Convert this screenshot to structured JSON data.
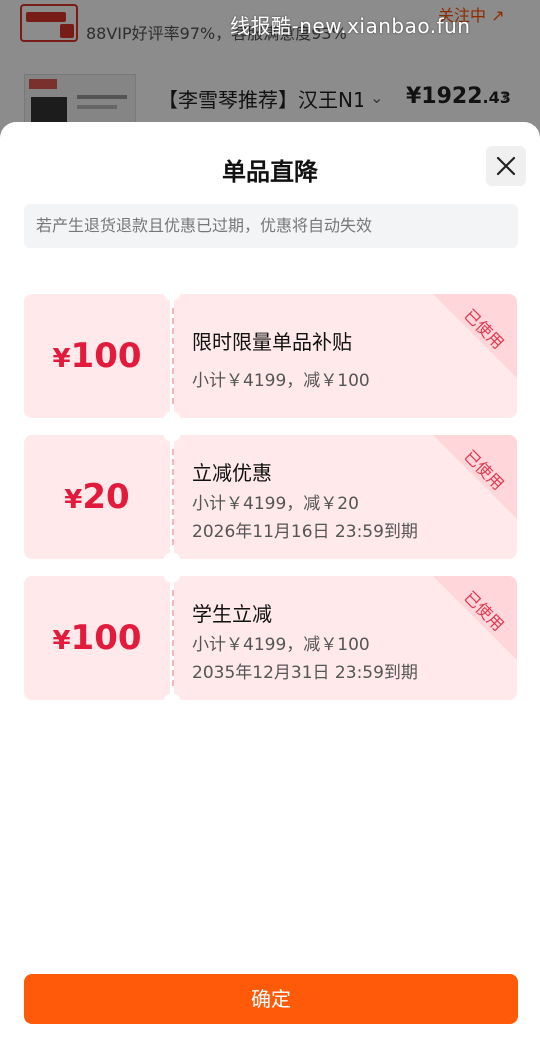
{
  "watermark": "线报酷-new.xianbao.fun",
  "background": {
    "shop_rating": "88VIP好评率97%，客服满意度93%",
    "follow_label": "关注中 ↗",
    "product_name": "【李雪琴推荐】汉王N1",
    "product_chevron": "⌄",
    "price_main": "¥1922",
    "price_decimal": ".43",
    "price_chevron": "›"
  },
  "sheet": {
    "title": "单品直降",
    "close_icon": "close-icon",
    "notice": "若产生退货退款且优惠已过期，优惠将自动失效",
    "confirm_label": "确定"
  },
  "coupons": [
    {
      "currency": "¥",
      "amount": "100",
      "name": "限时限量单品补贴",
      "subtotal": "小计￥4199，减￥100",
      "expiry": "",
      "status": "已使用"
    },
    {
      "currency": "¥",
      "amount": "20",
      "name": "立减优惠",
      "subtotal": "小计￥4199，减￥20",
      "expiry": "2026年11月16日 23:59到期",
      "status": "已使用"
    },
    {
      "currency": "¥",
      "amount": "100",
      "name": "学生立减",
      "subtotal": "小计￥4199，减￥100",
      "expiry": "2035年12月31日 23:59到期",
      "status": "已使用"
    }
  ],
  "colors": {
    "accent": "#ff5a0a",
    "coupon_red": "#e21b3c",
    "coupon_bg": "#ffe9eb"
  }
}
